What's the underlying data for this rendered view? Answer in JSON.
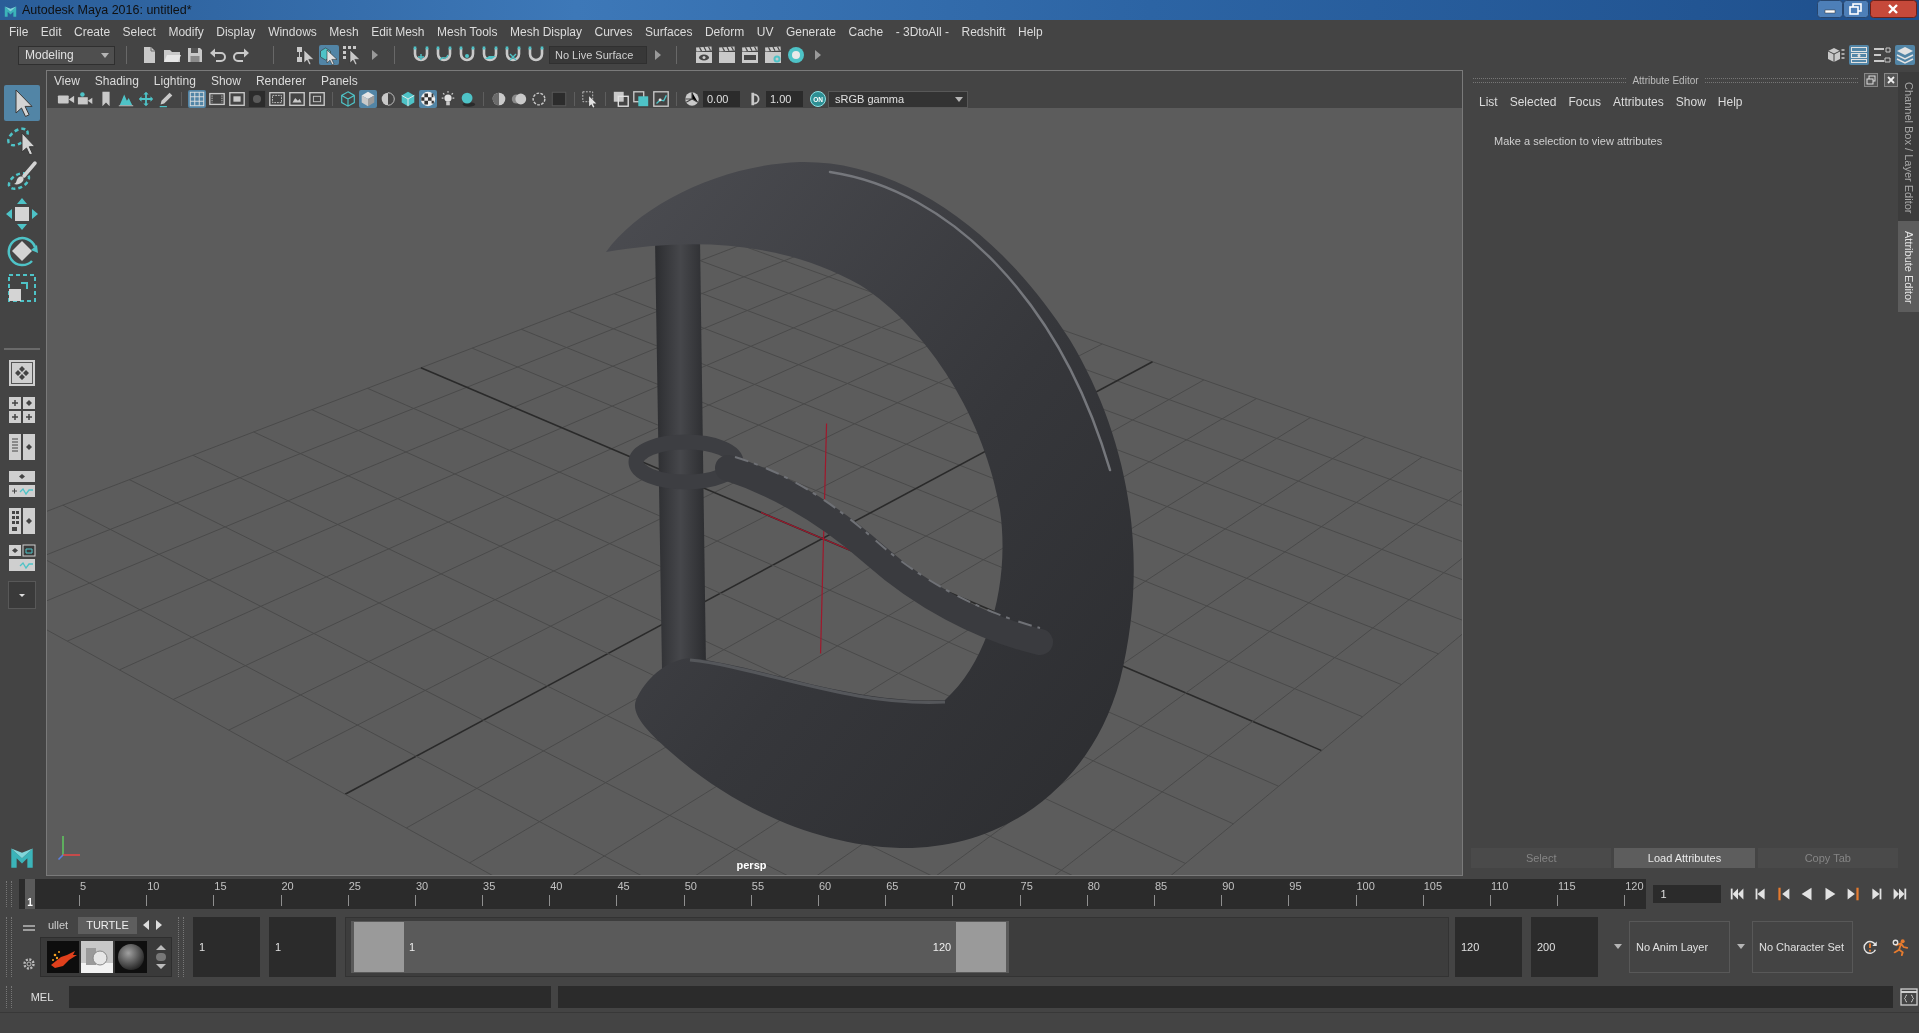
{
  "window": {
    "title": "Autodesk Maya 2016: untitled*"
  },
  "menu_bar": [
    "File",
    "Edit",
    "Create",
    "Select",
    "Modify",
    "Display",
    "Windows",
    "Mesh",
    "Edit Mesh",
    "Mesh Tools",
    "Mesh Display",
    "Curves",
    "Surfaces",
    "Deform",
    "UV",
    "Generate",
    "Cache",
    "- 3DtoAll -",
    "Redshift",
    "Help"
  ],
  "status_line": {
    "menu_set": "Modeling",
    "selection_modes": [
      {
        "kind": "hierarchy",
        "selected": false
      },
      {
        "kind": "object",
        "selected": true
      },
      {
        "kind": "component",
        "selected": false
      }
    ],
    "live_surface": "No Live Surface",
    "panel_toggles": [
      {
        "kind": "toolkit",
        "on": false
      },
      {
        "kind": "attribute-editor",
        "on": true
      },
      {
        "kind": "tool-settings",
        "on": false
      },
      {
        "kind": "channel-box",
        "on": true
      }
    ]
  },
  "toolbox": {
    "tools": [
      {
        "kind": "select",
        "selected": true
      },
      {
        "kind": "lasso",
        "selected": false
      },
      {
        "kind": "paint",
        "selected": false
      },
      {
        "kind": "move",
        "selected": false
      },
      {
        "kind": "rotate",
        "selected": false
      },
      {
        "kind": "scale",
        "selected": false
      }
    ]
  },
  "viewport": {
    "menu": [
      "View",
      "Shading",
      "Lighting",
      "Show",
      "Renderer",
      "Panels"
    ],
    "icon_groups": [
      [
        {
          "kind": "camera",
          "on": false
        },
        {
          "kind": "camera-attributes",
          "on": false
        },
        {
          "kind": "bookmark",
          "on": false
        },
        {
          "kind": "image-plane",
          "on": false
        },
        {
          "kind": "pan",
          "on": false
        },
        {
          "kind": "pencil",
          "on": false
        }
      ],
      [
        {
          "kind": "grid",
          "on": true
        },
        {
          "kind": "film-gate",
          "on": false
        },
        {
          "kind": "resolution-gate",
          "on": false
        },
        {
          "kind": "gate-mask",
          "on": false
        },
        {
          "kind": "field-chart",
          "on": false
        },
        {
          "kind": "safe-action",
          "on": false
        },
        {
          "kind": "safe-title",
          "on": false
        }
      ],
      [
        {
          "kind": "wireframe",
          "on": false
        },
        {
          "kind": "smooth-shade",
          "on": true
        },
        {
          "kind": "default-material",
          "on": false
        },
        {
          "kind": "wire-on-shaded",
          "on": false
        },
        {
          "kind": "textured",
          "on": true
        },
        {
          "kind": "lights",
          "on": false
        },
        {
          "kind": "shadows",
          "on": false
        }
      ],
      [
        {
          "kind": "ambient-occlusion",
          "on": false
        },
        {
          "kind": "motion-blur",
          "on": false
        },
        {
          "kind": "anti-aliasing",
          "on": false
        },
        {
          "kind": "depth-of-field",
          "on": false
        }
      ],
      [
        {
          "kind": "isolate",
          "on": false
        }
      ],
      [
        {
          "kind": "xray",
          "on": false
        },
        {
          "kind": "xray-active",
          "on": false
        },
        {
          "kind": "xray-joints",
          "on": false
        }
      ]
    ],
    "exposure": "0.00",
    "gamma": "1.00",
    "color_management": "ON",
    "color_space": "sRGB gamma",
    "camera": "persp"
  },
  "attribute_editor": {
    "title": "Attribute Editor",
    "menu": [
      "List",
      "Selected",
      "Focus",
      "Attributes",
      "Show",
      "Help"
    ],
    "message": "Make a selection to view attributes",
    "buttons": [
      {
        "label": "Select",
        "disabled": true
      },
      {
        "label": "Load Attributes",
        "disabled": false
      },
      {
        "label": "Copy Tab",
        "disabled": true
      }
    ]
  },
  "side_tabs": [
    {
      "label": "Channel Box / Layer Editor",
      "selected": false
    },
    {
      "label": "Attribute Editor",
      "selected": true
    }
  ],
  "time_slider": {
    "ticks": [
      "5",
      "10",
      "15",
      "20",
      "25",
      "30",
      "35",
      "40",
      "45",
      "50",
      "55",
      "60",
      "65",
      "70",
      "75",
      "80",
      "85",
      "90",
      "95",
      "100",
      "105",
      "110",
      "115",
      "120"
    ],
    "playhead": {
      "label": "1",
      "level": 0
    },
    "current_frame": "1"
  },
  "range_slider": {
    "animation_start": "1",
    "playback_start": "1",
    "range_start": "1",
    "range_end": "120",
    "level": 0.6,
    "playback_end": "120",
    "animation_end": "200",
    "anim_layer": "No Anim Layer",
    "character_set": "No Character Set"
  },
  "shelf": {
    "tabs": [
      {
        "label": "ullet",
        "selected": false
      },
      {
        "label": "TURTLE",
        "selected": true
      }
    ]
  },
  "command_line": {
    "language": "MEL"
  }
}
